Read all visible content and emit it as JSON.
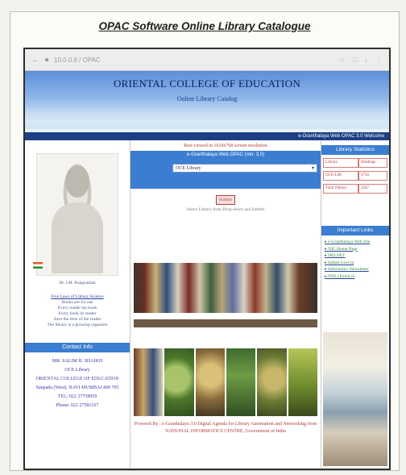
{
  "page": {
    "caption": "OPAC Software Online Library Catalogue"
  },
  "browser": {
    "url": "10.0.0.6  /  OPAC",
    "icons": [
      "back-icon",
      "lock-icon",
      "star-icon",
      "menu-icon"
    ]
  },
  "banner": {
    "college": "ORIENTAL COLLEGE OF EDUCATION",
    "subtitle": "Online Library Catalog"
  },
  "ticker": {
    "text": "e-Granthalaya Web OPAC 3.0  Welcome"
  },
  "left": {
    "portrait_caption": "Dr. I.M. Rangnathan",
    "library_rules_title": "Five Laws of Library Science",
    "library_rules": [
      "Books are for use",
      "Every reader his book",
      "Every book its reader",
      "Save the time of the reader",
      "The library is a growing organism"
    ],
    "contact_header": "Contact Info",
    "contact_lines": [
      "MR. SALIM H. SHAIKH",
      "OCE Library",
      "ORIENTAL COLLEGE OF EDUCATION",
      "Sanpada (West), NAVI MUMBAI 400 705",
      "TEL: 022 27758959",
      "Phone: 022 27581167"
    ]
  },
  "middle": {
    "notice": "Best viewed in 1024x768 screen resolution",
    "opac_header": "e-Granthalaya Web OPAC (Ver. 3.0)",
    "library_select_value": "OCE Library",
    "submit_label": "Submit",
    "hint": "Select Library from Drop-down and Submit",
    "footer": "Powered By : e-Granthalaya 3.0 Digital Agenda for Library Automation and Networking from NATIONAL INFORMATICS CENTRE, Government of India"
  },
  "right": {
    "stats_header": "Library Statistics",
    "stats": [
      {
        "k": "Library",
        "v": "Holdings"
      },
      {
        "k": "OCE-LIB",
        "v": "4750"
      },
      {
        "k": "Total Title(s)",
        "v": "3567"
      }
    ],
    "important_header": "Important Links",
    "links": [
      "e-Granthalaya Web Site",
      "NIC Home Page",
      "DELNET",
      "Indian Govt.in",
      "Informatics Newsletter",
      "NDLI Portal.in"
    ]
  },
  "colors": {
    "blue": "#3a7dd1",
    "navy": "#0c1a66",
    "red": "#b23838"
  }
}
